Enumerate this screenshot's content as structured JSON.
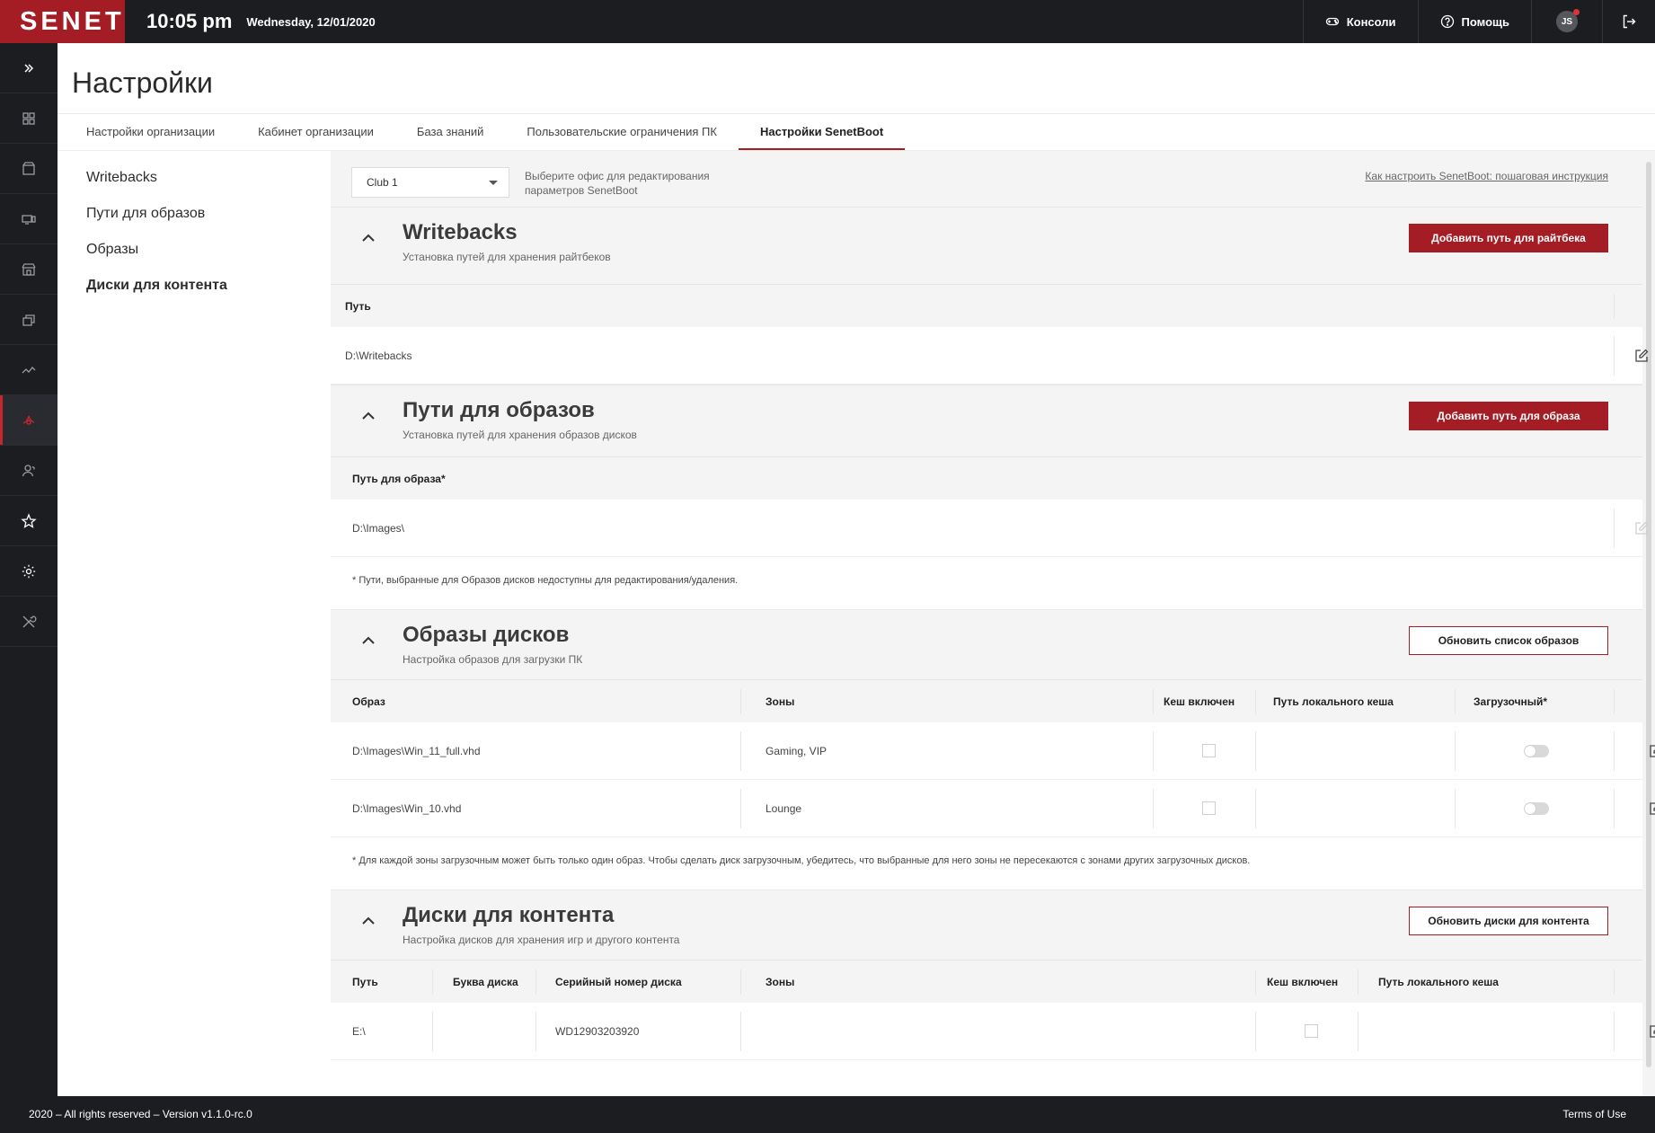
{
  "header": {
    "logo_text": "SENET",
    "time": "10:05 pm",
    "date": "Wednesday, 12/01/2020",
    "consoles_label": "Консоли",
    "help_label": "Помощь",
    "avatar_initials": "JS",
    "brand_color": "#a51d24"
  },
  "sidebar": {
    "items": [
      {
        "icon": "expand-icon"
      },
      {
        "icon": "consoles-icon"
      },
      {
        "icon": "store-icon"
      },
      {
        "icon": "devices-icon"
      },
      {
        "icon": "shop-icon"
      },
      {
        "icon": "layers-icon"
      },
      {
        "icon": "analytics-icon"
      },
      {
        "icon": "boot-settings-icon",
        "active": true
      },
      {
        "icon": "users-icon"
      },
      {
        "icon": "star-icon"
      },
      {
        "icon": "gear-icon"
      },
      {
        "icon": "tools-icon"
      }
    ]
  },
  "page": {
    "title": "Настройки",
    "tabs": [
      {
        "label": "Настройки организации"
      },
      {
        "label": "Кабинет организации"
      },
      {
        "label": "База знаний"
      },
      {
        "label": "Пользовательские ограничения ПК"
      },
      {
        "label": "Настройки SenetBoot",
        "active": true
      }
    ]
  },
  "subnav": {
    "items": [
      {
        "label": "Writebacks"
      },
      {
        "label": "Пути для образов"
      },
      {
        "label": "Образы"
      },
      {
        "label": "Диски для контента",
        "active": true
      }
    ]
  },
  "office": {
    "selected": "Club 1",
    "hint": "Выберите офис для редактирования параметров SenetBoot",
    "guide_link": "Как настроить SenetBoot: пошаговая инструкция"
  },
  "writebacks": {
    "title": "Writebacks",
    "subtitle": "Установка путей для хранения райтбеков",
    "add_button": "Добавить  путь для райтбека",
    "col_path": "Путь",
    "rows": [
      {
        "path": "D:\\Writebacks"
      }
    ]
  },
  "image_paths": {
    "title": "Пути для образов",
    "subtitle": "Установка путей для хранения образов дисков",
    "add_button": "Добавить  путь для образа",
    "col_path": "Путь для образа*",
    "rows": [
      {
        "path": "D:\\Images\\"
      }
    ],
    "note": "* Пути, выбранные для Образов дисков недоступны для редактирования/удаления."
  },
  "disk_images": {
    "title": "Образы дисков",
    "subtitle": "Настройка образов для загрузки ПК",
    "refresh_button": "Обновить список образов",
    "columns": {
      "image": "Образ",
      "zones": "Зоны",
      "cache": "Кеш включен",
      "cache_path": "Путь локального кеша",
      "bootable": "Загрузочный*"
    },
    "rows": [
      {
        "image": "D:\\Images\\Win_11_full.vhd",
        "zones": "Gaming, VIP",
        "cache": false,
        "bootable": false
      },
      {
        "image": "D:\\Images\\Win_10.vhd",
        "zones": "Lounge",
        "cache": false,
        "bootable": false
      }
    ],
    "note": "* Для каждой зоны загрузочным может быть только один образ. Чтобы сделать диск загрузочным, убедитесь, что выбранные для него зоны не пересекаются с зонами других загрузочных дисков."
  },
  "content_disks": {
    "title": "Диски для контента",
    "subtitle": "Настройка дисков для хранения игр и другого контента",
    "refresh_button": "Обновить  диски для контента",
    "columns": {
      "path": "Путь",
      "letter": "Буква диска",
      "serial": "Серийный номер диска",
      "zones": "Зоны",
      "cache": "Кеш включен",
      "cache_path": "Путь локального кеша"
    },
    "rows": [
      {
        "path": "E:\\",
        "letter": "",
        "serial": "WD12903203920",
        "zones": "",
        "cache": false
      }
    ]
  },
  "footer": {
    "copyright": "2020 – All rights reserved – Version v1.1.0-rc.0",
    "terms": "Terms of Use"
  }
}
